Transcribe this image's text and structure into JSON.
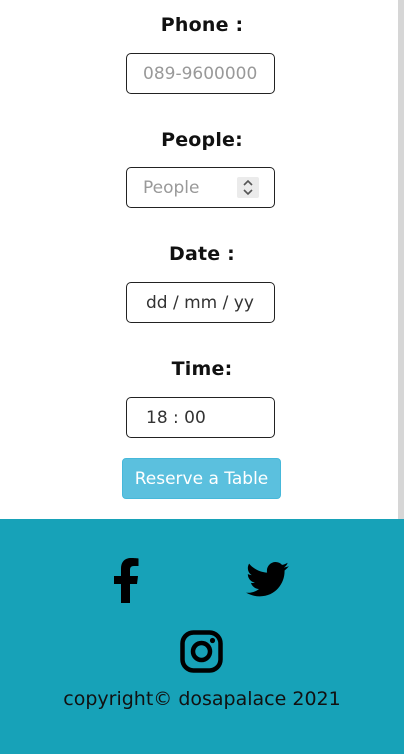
{
  "form": {
    "phone": {
      "label": "Phone :",
      "placeholder": "089-9600000"
    },
    "people": {
      "label": "People:",
      "placeholder": "People"
    },
    "date": {
      "label": "Date :",
      "display": "dd / mm / yy"
    },
    "time": {
      "label": "Time:",
      "value": "18 : 00"
    },
    "submit_label": "Reserve a Table"
  },
  "footer": {
    "icons": [
      "facebook-icon",
      "twitter-icon",
      "instagram-icon"
    ],
    "copyright": "copyright© dosapalace 2021"
  },
  "colors": {
    "footer_bg": "#17a2b8",
    "button_bg": "#5bc0de"
  }
}
